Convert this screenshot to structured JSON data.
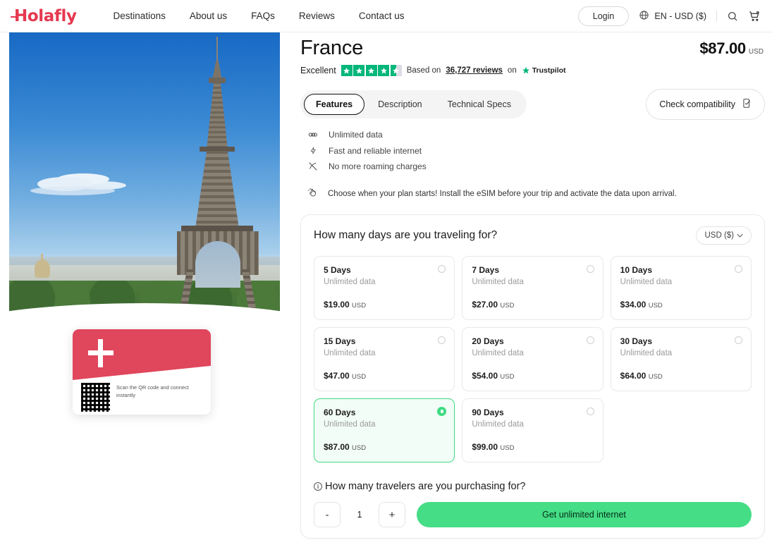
{
  "header": {
    "logo": "Holafly",
    "nav": [
      {
        "label": "Destinations"
      },
      {
        "label": "About us"
      },
      {
        "label": "FAQs"
      },
      {
        "label": "Reviews"
      },
      {
        "label": "Contact us"
      }
    ],
    "login_label": "Login",
    "locale_label": "EN - USD ($)",
    "globe_icon": "globe-icon",
    "search_icon": "search-icon",
    "cart_icon": "cart-icon"
  },
  "product": {
    "title": "France",
    "price": "$87.00",
    "price_currency": "USD"
  },
  "rating": {
    "word": "Excellent",
    "stars": 4.5,
    "based_on_prefix": "Based on",
    "reviews": "36,727 reviews",
    "on_label": "on",
    "provider": "Trustpilot",
    "star_color": "#00b67a",
    "empty_star_color": "#dcdce6"
  },
  "tabs": [
    {
      "label": "Features",
      "active": true
    },
    {
      "label": "Description",
      "active": false
    },
    {
      "label": "Technical Specs",
      "active": false
    }
  ],
  "compatibility": {
    "label": "Check compatibility",
    "icon": "phone-check-icon"
  },
  "features": [
    {
      "icon": "infinity-icon",
      "label": "Unlimited data"
    },
    {
      "icon": "bolt-icon",
      "label": "Fast and reliable internet"
    },
    {
      "icon": "no-roaming-icon",
      "label": "No more roaming charges"
    }
  ],
  "notice": {
    "icon": "tap-hand-icon",
    "text": "Choose when your plan starts! Install the eSIM before your trip and activate the data upon arrival."
  },
  "plan_panel": {
    "title": "How many days are you traveling for?",
    "currency_selector": "USD ($)",
    "plans": [
      {
        "days": "5 Days",
        "sub": "Unlimited data",
        "price": "$19.00",
        "currency": "USD",
        "selected": false
      },
      {
        "days": "7 Days",
        "sub": "Unlimited data",
        "price": "$27.00",
        "currency": "USD",
        "selected": false
      },
      {
        "days": "10 Days",
        "sub": "Unlimited data",
        "price": "$34.00",
        "currency": "USD",
        "selected": false
      },
      {
        "days": "15 Days",
        "sub": "Unlimited data",
        "price": "$47.00",
        "currency": "USD",
        "selected": false
      },
      {
        "days": "20 Days",
        "sub": "Unlimited data",
        "price": "$54.00",
        "currency": "USD",
        "selected": false
      },
      {
        "days": "30 Days",
        "sub": "Unlimited data",
        "price": "$64.00",
        "currency": "USD",
        "selected": false
      },
      {
        "days": "60 Days",
        "sub": "Unlimited data",
        "price": "$87.00",
        "currency": "USD",
        "selected": true
      },
      {
        "days": "90 Days",
        "sub": "Unlimited data",
        "price": "$99.00",
        "currency": "USD",
        "selected": false
      }
    ],
    "selected_accent": "#3ddb82"
  },
  "travelers": {
    "info_icon": "info-icon",
    "question": "How many travelers are you purchasing for?",
    "decrement": "-",
    "quantity": "1",
    "increment": "+",
    "cta_label": "Get unlimited internet",
    "cta_color": "#45dd85"
  },
  "qr_card": {
    "text": "Scan the QR code and connect instantly",
    "brand_color": "#e0465c",
    "logo_icon": "holafly-h-icon",
    "qr_icon": "qr-code-icon"
  }
}
